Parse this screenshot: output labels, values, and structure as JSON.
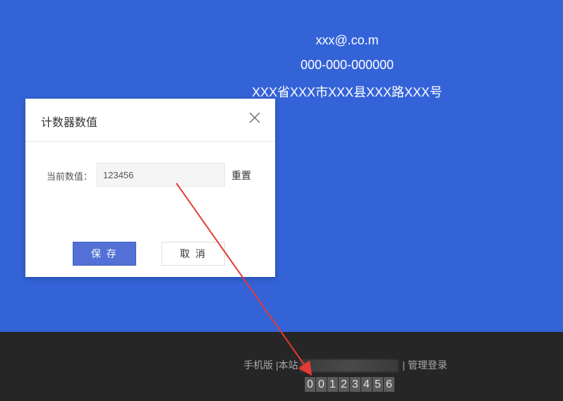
{
  "contact": {
    "email": "xxx@.co.m",
    "phone": "000-000-000000",
    "address": "XXX省XXX市XXX县XXX路XXX号"
  },
  "dialog": {
    "title": "计数器数值",
    "field_label": "当前数值：",
    "field_value": "123456",
    "reset_label": "重置",
    "save_label": "保 存",
    "cancel_label": "取 消"
  },
  "footer": {
    "mobile_link": "手机版",
    "site_prefix": "|本站",
    "admin_link": "| 管理登录",
    "counter_digits": [
      "0",
      "0",
      "1",
      "2",
      "3",
      "4",
      "5",
      "6"
    ]
  },
  "colors": {
    "hero_bg": "#3463d8",
    "footer_bg": "#262626",
    "primary_button": "#5270d6",
    "arrow": "#e53935"
  }
}
